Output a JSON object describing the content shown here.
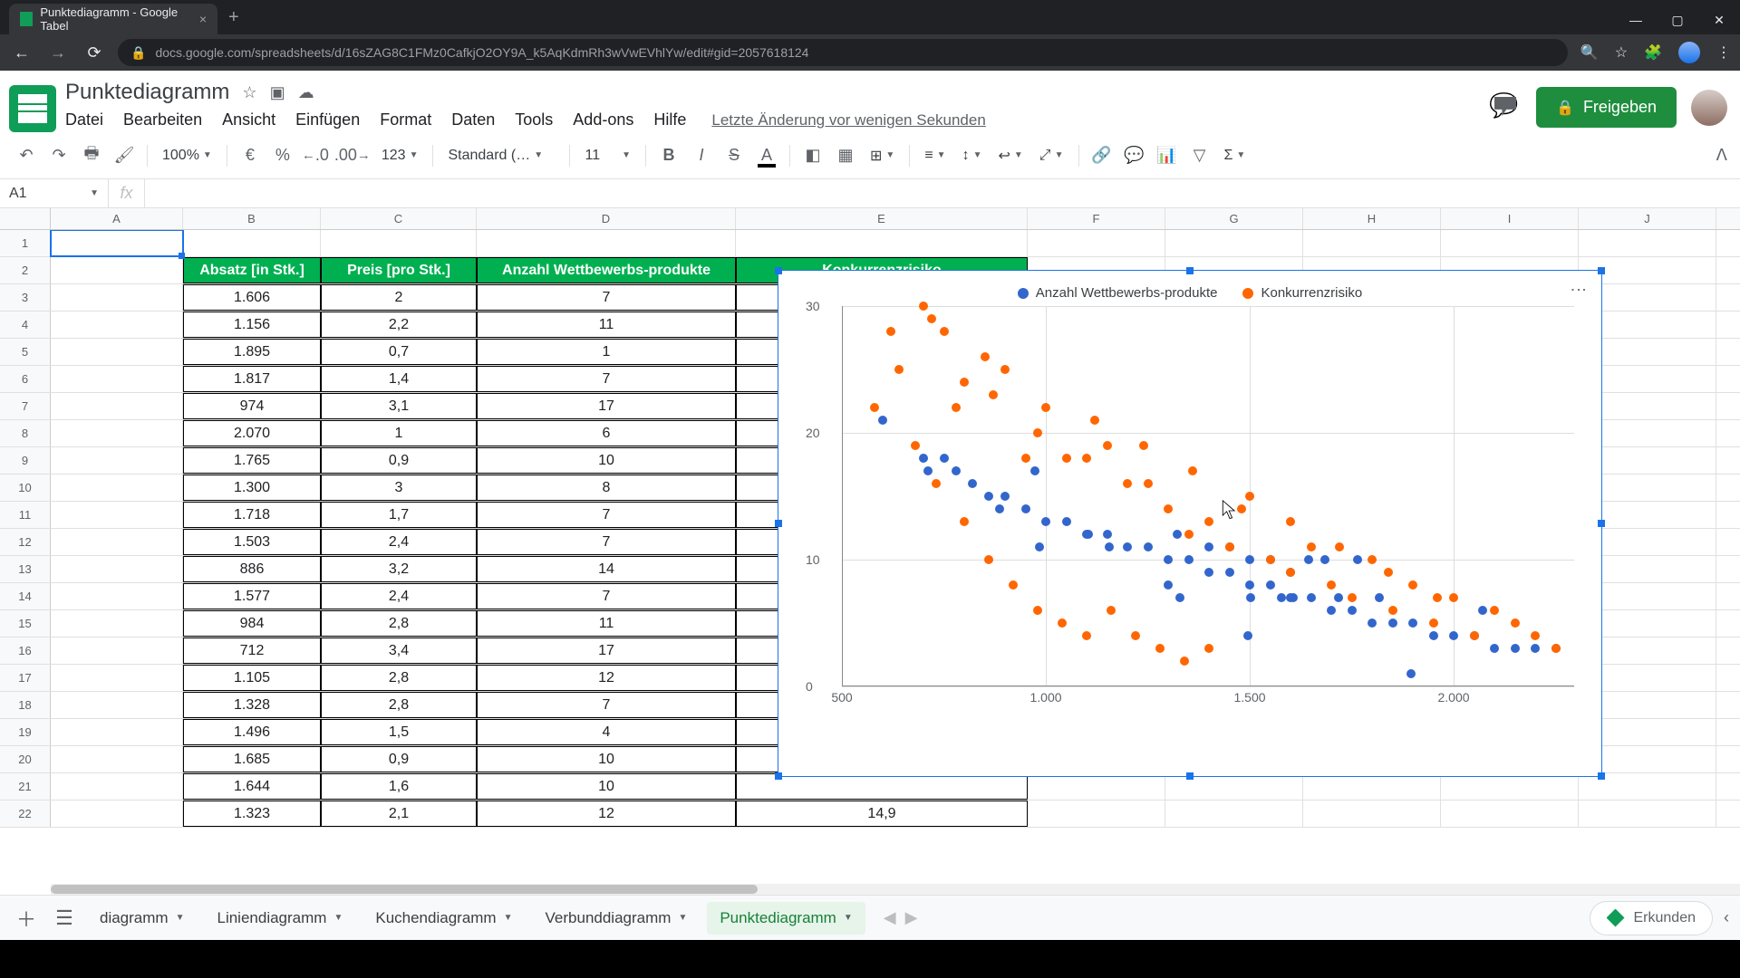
{
  "browser": {
    "tab_title": "Punktediagramm - Google Tabel",
    "url": "docs.google.com/spreadsheets/d/16sZAG8C1FMz0CafkjO2OY9A_k5AqKdmRh3wVwEVhlYw/edit#gid=2057618124"
  },
  "doc": {
    "title": "Punktediagramm",
    "last_saved": "Letzte Änderung vor wenigen Sekunden",
    "share": "Freigeben"
  },
  "menu": {
    "datei": "Datei",
    "bearbeiten": "Bearbeiten",
    "ansicht": "Ansicht",
    "einfuegen": "Einfügen",
    "format": "Format",
    "daten": "Daten",
    "tools": "Tools",
    "addons": "Add-ons",
    "hilfe": "Hilfe"
  },
  "toolbar": {
    "zoom": "100%",
    "euro": "€",
    "pct": "%",
    "dec_dec": ".0",
    "dec_inc": ".00",
    "numfmt": "123",
    "font": "Standard (…",
    "size": "11"
  },
  "namebox": "A1",
  "columns": [
    "A",
    "B",
    "C",
    "D",
    "E",
    "F",
    "G",
    "H",
    "I",
    "J"
  ],
  "rownums": [
    "1",
    "2",
    "3",
    "4",
    "5",
    "6",
    "7",
    "8",
    "9",
    "10",
    "11",
    "12",
    "13",
    "14",
    "15",
    "16",
    "17",
    "18",
    "19",
    "20",
    "21",
    "22"
  ],
  "headers": {
    "B": "Absatz [in Stk.]",
    "C": "Preis [pro Stk.]",
    "D": "Anzahl Wettbewerbs-produkte",
    "E": "Konkurrenzrisiko"
  },
  "rows": [
    {
      "B": "1.606",
      "C": "2",
      "D": "7"
    },
    {
      "B": "1.156",
      "C": "2,2",
      "D": "11"
    },
    {
      "B": "1.895",
      "C": "0,7",
      "D": "1"
    },
    {
      "B": "1.817",
      "C": "1,4",
      "D": "7"
    },
    {
      "B": "974",
      "C": "3,1",
      "D": "17"
    },
    {
      "B": "2.070",
      "C": "1",
      "D": "6"
    },
    {
      "B": "1.765",
      "C": "0,9",
      "D": "10"
    },
    {
      "B": "1.300",
      "C": "3",
      "D": "8"
    },
    {
      "B": "1.718",
      "C": "1,7",
      "D": "7"
    },
    {
      "B": "1.503",
      "C": "2,4",
      "D": "7"
    },
    {
      "B": "886",
      "C": "3,2",
      "D": "14"
    },
    {
      "B": "1.577",
      "C": "2,4",
      "D": "7"
    },
    {
      "B": "984",
      "C": "2,8",
      "D": "11"
    },
    {
      "B": "712",
      "C": "3,4",
      "D": "17"
    },
    {
      "B": "1.105",
      "C": "2,8",
      "D": "12"
    },
    {
      "B": "1.328",
      "C": "2,8",
      "D": "7"
    },
    {
      "B": "1.496",
      "C": "1,5",
      "D": "4"
    },
    {
      "B": "1.685",
      "C": "0,9",
      "D": "10"
    },
    {
      "B": "1.644",
      "C": "1,6",
      "D": "10"
    },
    {
      "B": "1.323",
      "C": "2,1",
      "D": "12"
    }
  ],
  "cell_E22": "14,9",
  "chart_data": {
    "type": "scatter",
    "xlabel": "",
    "ylabel": "",
    "xlim": [
      500,
      2300
    ],
    "ylim": [
      0,
      30
    ],
    "xticks": [
      "500",
      "1.000",
      "1.500",
      "2.000"
    ],
    "yticks": [
      "0",
      "10",
      "20",
      "30"
    ],
    "legend": [
      "Anzahl Wettbewerbs-produkte",
      "Konkurrenzrisiko"
    ],
    "series": [
      {
        "name": "Anzahl Wettbewerbs-produkte",
        "color": "#3366cc",
        "points": [
          [
            1606,
            7
          ],
          [
            1156,
            11
          ],
          [
            1895,
            1
          ],
          [
            1817,
            7
          ],
          [
            974,
            17
          ],
          [
            2070,
            6
          ],
          [
            1765,
            10
          ],
          [
            1300,
            8
          ],
          [
            1718,
            7
          ],
          [
            1503,
            7
          ],
          [
            886,
            14
          ],
          [
            1577,
            7
          ],
          [
            984,
            11
          ],
          [
            712,
            17
          ],
          [
            1105,
            12
          ],
          [
            1328,
            7
          ],
          [
            1496,
            4
          ],
          [
            1685,
            10
          ],
          [
            1644,
            10
          ],
          [
            1323,
            12
          ],
          [
            600,
            21
          ],
          [
            700,
            18
          ],
          [
            750,
            18
          ],
          [
            780,
            17
          ],
          [
            820,
            16
          ],
          [
            860,
            15
          ],
          [
            900,
            15
          ],
          [
            950,
            14
          ],
          [
            1000,
            13
          ],
          [
            1050,
            13
          ],
          [
            1100,
            12
          ],
          [
            1150,
            12
          ],
          [
            1200,
            11
          ],
          [
            1250,
            11
          ],
          [
            1300,
            10
          ],
          [
            1350,
            10
          ],
          [
            1400,
            9
          ],
          [
            1450,
            9
          ],
          [
            1500,
            8
          ],
          [
            1550,
            8
          ],
          [
            1600,
            7
          ],
          [
            1650,
            7
          ],
          [
            1700,
            6
          ],
          [
            1750,
            6
          ],
          [
            1800,
            5
          ],
          [
            1850,
            5
          ],
          [
            1900,
            5
          ],
          [
            1950,
            4
          ],
          [
            2000,
            4
          ],
          [
            2050,
            4
          ],
          [
            2100,
            3
          ],
          [
            2150,
            3
          ],
          [
            2200,
            3
          ],
          [
            2250,
            3
          ],
          [
            1400,
            11
          ],
          [
            1450,
            11
          ],
          [
            1500,
            10
          ],
          [
            1550,
            10
          ],
          [
            1600,
            9
          ]
        ]
      },
      {
        "name": "Konkurrenzrisiko",
        "color": "#ff6600",
        "points": [
          [
            620,
            28
          ],
          [
            700,
            30
          ],
          [
            720,
            29
          ],
          [
            750,
            28
          ],
          [
            780,
            22
          ],
          [
            800,
            24
          ],
          [
            850,
            26
          ],
          [
            870,
            23
          ],
          [
            900,
            25
          ],
          [
            950,
            18
          ],
          [
            980,
            20
          ],
          [
            1000,
            22
          ],
          [
            1050,
            18
          ],
          [
            1100,
            18
          ],
          [
            1150,
            19
          ],
          [
            1200,
            16
          ],
          [
            1250,
            16
          ],
          [
            1300,
            14
          ],
          [
            1350,
            12
          ],
          [
            1400,
            13
          ],
          [
            1450,
            11
          ],
          [
            1500,
            15
          ],
          [
            1550,
            10
          ],
          [
            1600,
            9
          ],
          [
            1650,
            11
          ],
          [
            1700,
            8
          ],
          [
            1750,
            7
          ],
          [
            1800,
            10
          ],
          [
            1850,
            6
          ],
          [
            1900,
            8
          ],
          [
            1950,
            5
          ],
          [
            2000,
            7
          ],
          [
            2050,
            4
          ],
          [
            2100,
            6
          ],
          [
            2150,
            5
          ],
          [
            2200,
            4
          ],
          [
            2250,
            3
          ],
          [
            680,
            19
          ],
          [
            730,
            16
          ],
          [
            800,
            13
          ],
          [
            860,
            10
          ],
          [
            920,
            8
          ],
          [
            980,
            6
          ],
          [
            1040,
            5
          ],
          [
            1100,
            4
          ],
          [
            1160,
            6
          ],
          [
            1220,
            4
          ],
          [
            1280,
            3
          ],
          [
            1340,
            2
          ],
          [
            1400,
            3
          ],
          [
            580,
            22
          ],
          [
            640,
            25
          ],
          [
            1120,
            21
          ],
          [
            1240,
            19
          ],
          [
            1360,
            17
          ],
          [
            1480,
            14
          ],
          [
            1600,
            13
          ],
          [
            1720,
            11
          ],
          [
            1840,
            9
          ],
          [
            1960,
            7
          ]
        ]
      }
    ]
  },
  "sheets": {
    "partial": "diagramm",
    "linien": "Liniendiagramm",
    "kuchen": "Kuchendiagramm",
    "verbund": "Verbunddiagramm",
    "punkte": "Punktediagramm"
  },
  "explore": "Erkunden"
}
